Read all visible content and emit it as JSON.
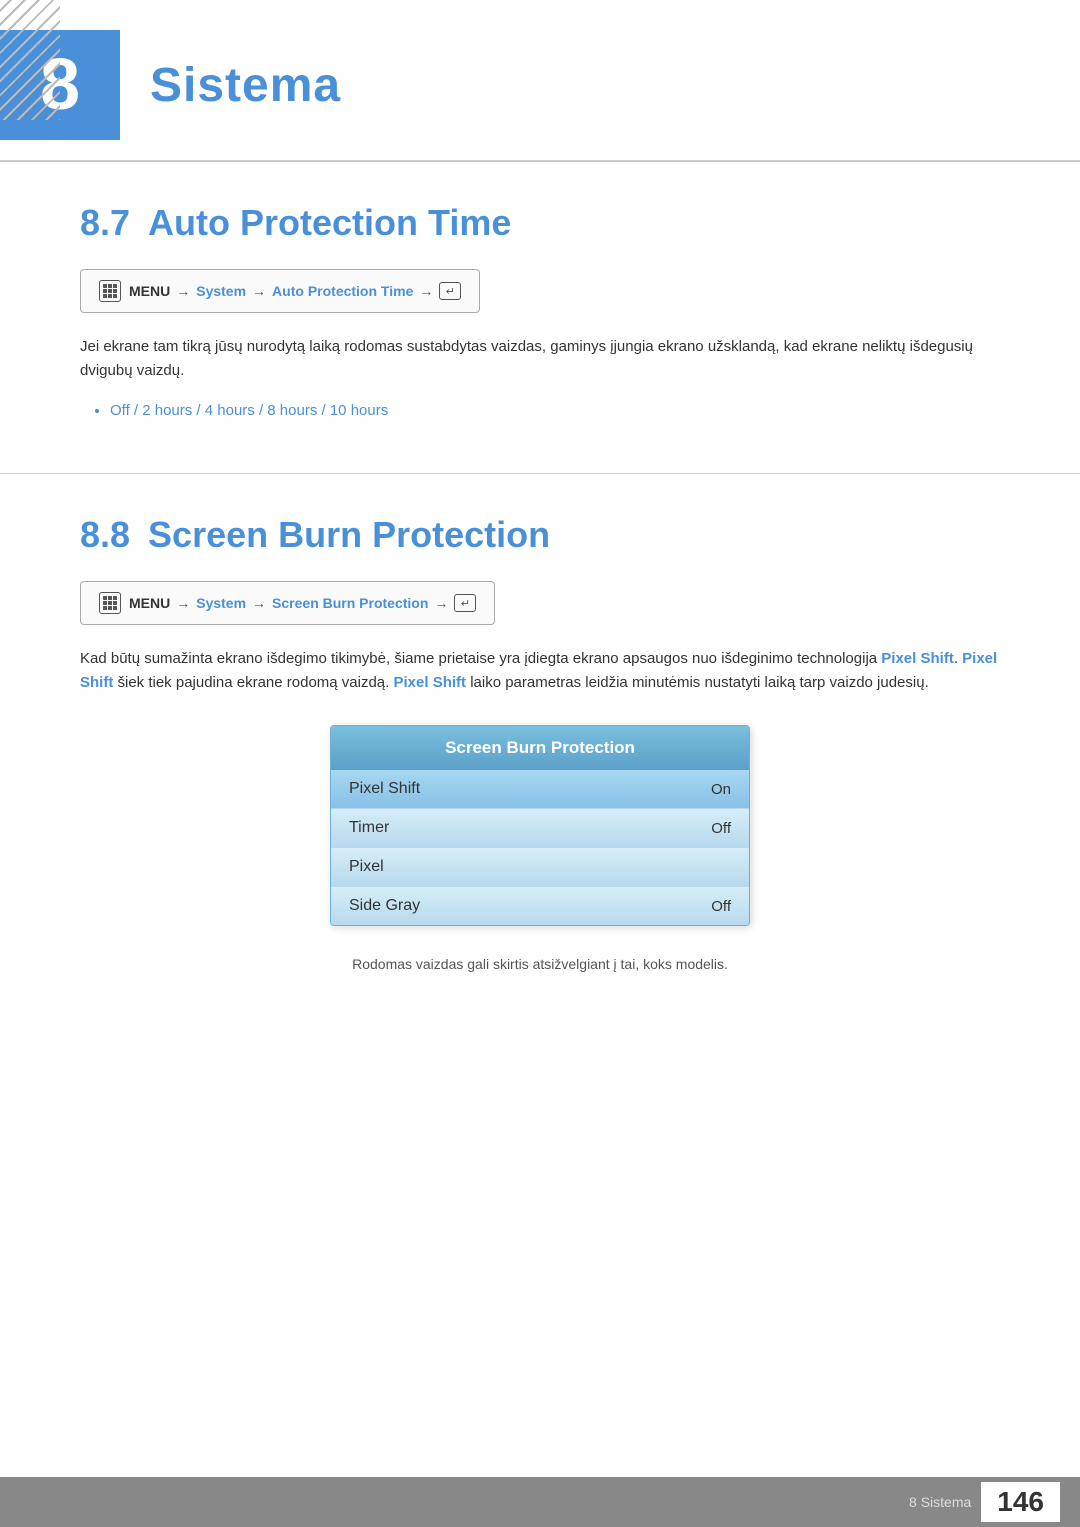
{
  "chapter": {
    "number": "8",
    "title": "Sistema"
  },
  "section_7": {
    "number": "8.7",
    "title": "Auto Protection Time",
    "menu_path": {
      "menu_word": "MENU",
      "arrow1": "→",
      "system": "System",
      "arrow2": "→",
      "item": "Auto Protection Time",
      "arrow3": "→",
      "enter": "ENTER"
    },
    "body_text": "Jei ekrane tam tikrą jūsų nurodytą laiką rodomas sustabdytas vaizdas, gaminys įjungia ekrano užsklandą, kad ekrane neliktų išdegusių dvigubų vaizdų.",
    "bullet": "Off / 2 hours / 4 hours / 8 hours / 10 hours"
  },
  "section_8": {
    "number": "8.8",
    "title": "Screen Burn Protection",
    "menu_path": {
      "menu_word": "MENU",
      "arrow1": "→",
      "system": "System",
      "arrow2": "→",
      "item": "Screen Burn Protection",
      "arrow3": "→",
      "enter": "ENTER"
    },
    "body_text_1": "Kad būtų sumažinta ekrano išdegimo tikimybė, šiame prietaise yra įdiegta ekrano apsaugos nuo išdeginimo technologija ",
    "bold_1": "Pixel Shift",
    "body_text_2": ". ",
    "bold_2": "Pixel Shift",
    "body_text_3": " šiek tiek pajudina ekrane rodomą vaizdą. ",
    "bold_3": "Pixel Shift",
    "body_text_4": " laiko parametras leidžia minutėmis nustatyti laiką tarp vaizdo judesių.",
    "dialog": {
      "header": "Screen Burn Protection",
      "rows": [
        {
          "label": "Pixel Shift",
          "value": "On",
          "selected": true
        },
        {
          "label": "Timer",
          "value": "Off",
          "selected": false
        },
        {
          "label": "Pixel",
          "value": "",
          "selected": false
        },
        {
          "label": "Side Gray",
          "value": "Off",
          "selected": false
        }
      ]
    },
    "footer_note": "Rodomas vaizdas gali skirtis atsižvelgiant į tai, koks modelis."
  },
  "footer": {
    "chapter_label": "8 Sistema",
    "page_number": "146"
  }
}
